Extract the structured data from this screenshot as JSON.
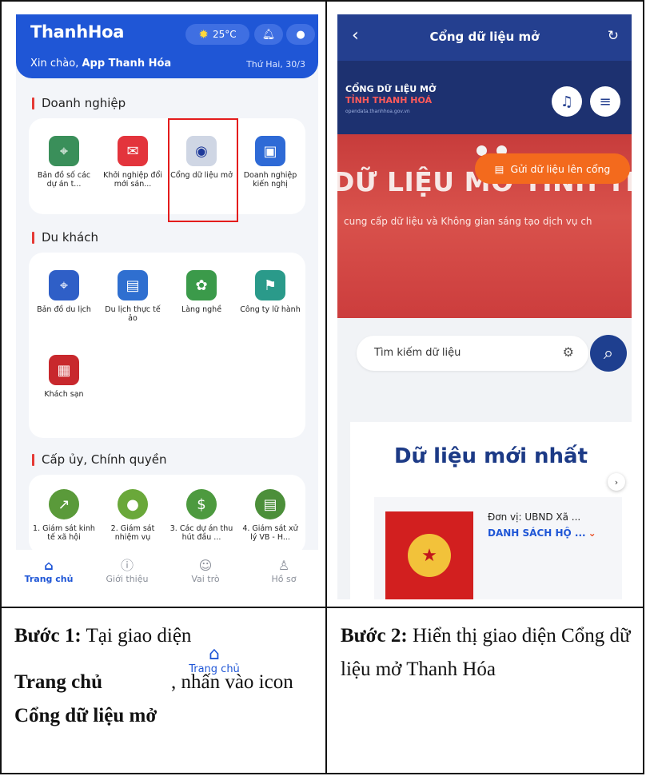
{
  "phone1": {
    "brand": "ThanhHoa",
    "weather": "25°C",
    "greeting_prefix": "Xin chào, ",
    "greeting_name": "App Thanh Hóa",
    "date": "Thứ Hai, 30/3",
    "sections": [
      {
        "title": "Doanh nghiệp",
        "items": [
          {
            "label": "Bản đồ số các dự án t...",
            "icon": "map-icon",
            "color": "#3a8f5a"
          },
          {
            "label": "Khởi nghiệp đổi mới sán...",
            "icon": "startup-icon",
            "color": "#e3343c"
          },
          {
            "label": "Cổng dữ liệu mở",
            "icon": "data-portal-icon",
            "color": "#cfd6e4"
          },
          {
            "label": "Doanh nghiệp kiến nghị",
            "icon": "briefcase-icon",
            "color": "#2e6ad6"
          }
        ]
      },
      {
        "title": "Du khách",
        "items": [
          {
            "label": "Bản đồ du lịch",
            "icon": "travel-map-icon",
            "color": "#2f5fc7"
          },
          {
            "label": "Du lịch thực tế ảo",
            "icon": "vr-tour-icon",
            "color": "#2f6fd0"
          },
          {
            "label": "Làng nghề",
            "icon": "craft-village-icon",
            "color": "#3b9a4a"
          },
          {
            "label": "Công ty lữ hành",
            "icon": "travel-company-icon",
            "color": "#2a9a8a"
          },
          {
            "label": "Khách sạn",
            "icon": "hotel-icon",
            "color": "#c8282d"
          }
        ]
      },
      {
        "title": "Cấp ủy, Chính quyền",
        "items": [
          {
            "label": "1. Giám sát kinh tế xã hội",
            "icon": "economy-monitor-icon",
            "color": "#5a9a3a"
          },
          {
            "label": "2. Giám sát nhiệm vụ",
            "icon": "task-monitor-icon",
            "color": "#6aa83a"
          },
          {
            "label": "3. Các dự án thu hút đầu ...",
            "icon": "investment-icon",
            "color": "#4d9a3f"
          },
          {
            "label": "4. Giám sát xử lý VB - H...",
            "icon": "document-monitor-icon",
            "color": "#4c8f3a"
          }
        ]
      }
    ],
    "nav": [
      {
        "label": "Trang chủ",
        "icon": "home-icon"
      },
      {
        "label": "Giới thiệu",
        "icon": "info-icon"
      },
      {
        "label": "Vai trò",
        "icon": "role-icon"
      },
      {
        "label": "Hồ sơ",
        "icon": "profile-icon"
      }
    ]
  },
  "phone2": {
    "title": "Cổng dữ liệu mở",
    "portal_line1": "CỔNG DỮ LIỆU MỞ",
    "portal_line2": "TỈNH THANH HOÁ",
    "portal_url": "opendata.thanhhoa.gov.vn",
    "hero_heading": "DỮ LIỆU MỞ TỈNH THAN",
    "hero_sub": "cung cấp dữ liệu và Không gian sáng tạo dịch vụ ch",
    "search_placeholder": "Tìm kiếm dữ liệu",
    "latest_heading": "Dữ liệu mới nhất",
    "item_unit": "Đơn vị: UBND Xã ...",
    "item_title": "DANH SÁCH HỘ ...",
    "send_button": "Gửi dữ liệu lên cổng"
  },
  "captions": {
    "step1_label": "Bước 1:",
    "step1_text1": "Tại giao diện",
    "step1_bold": "Trang chủ",
    "step1_inline": "Trang chủ",
    "step1_text2": ", nhấn vào icon",
    "step1_bold2": "Cổng dữ liệu mở",
    "step2_label": "Bước 2:",
    "step2_text": "Hiển thị giao diện Cổng dữ liệu mở Thanh Hóa"
  }
}
